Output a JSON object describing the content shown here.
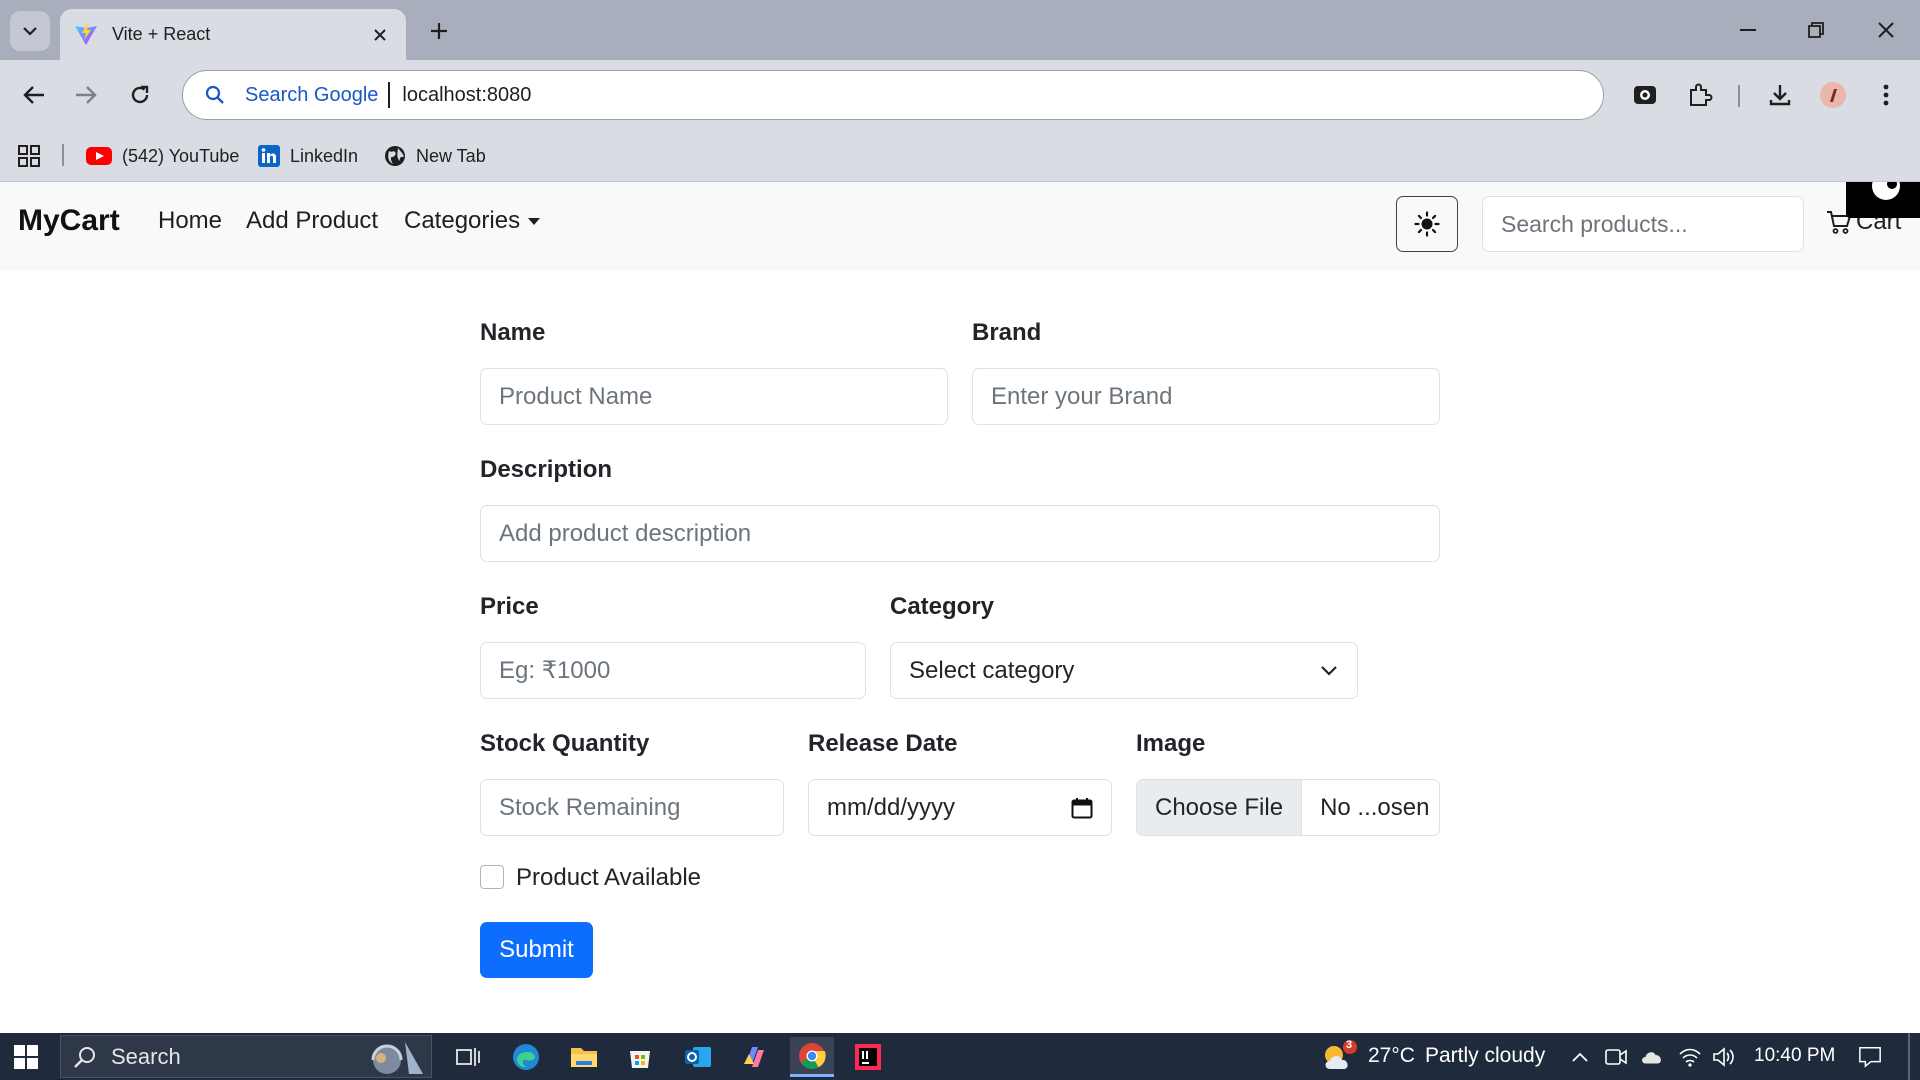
{
  "browser": {
    "tab_title": "Vite + React",
    "omnibox_hint": "Search Google",
    "url": "localhost:8080",
    "bookmarks": [
      {
        "label": "(542) YouTube",
        "icon": "youtube-icon"
      },
      {
        "label": "LinkedIn",
        "icon": "linkedin-icon"
      },
      {
        "label": "New Tab",
        "icon": "globe-icon"
      }
    ]
  },
  "navbar": {
    "brand": "MyCart",
    "links": [
      "Home",
      "Add Product",
      "Categories"
    ],
    "theme_icon": "sun-icon",
    "search_placeholder": "Search products...",
    "cart_label": "Cart"
  },
  "form": {
    "name_label": "Name",
    "name_placeholder": "Product Name",
    "brand_label": "Brand",
    "brand_placeholder": "Enter your Brand",
    "description_label": "Description",
    "description_placeholder": "Add product description",
    "price_label": "Price",
    "price_placeholder": "Eg: ₹1000",
    "category_label": "Category",
    "category_selected": "Select category",
    "stock_label": "Stock Quantity",
    "stock_placeholder": "Stock Remaining",
    "release_label": "Release Date",
    "release_placeholder": "mm/dd/yyyy",
    "image_label": "Image",
    "file_button": "Choose File",
    "file_name": "No ...osen",
    "available_label": "Product Available",
    "submit_label": "Submit"
  },
  "taskbar": {
    "search_label": "Search",
    "weather_badge": "3",
    "weather_temp": "27°C",
    "weather_text": "Partly cloudy",
    "time": "10:40 PM"
  },
  "colors": {
    "primary": "#0d6efd",
    "taskbar": "#202a3d",
    "tabstrip": "#a8aebc",
    "toolbar": "#d9dce3"
  }
}
